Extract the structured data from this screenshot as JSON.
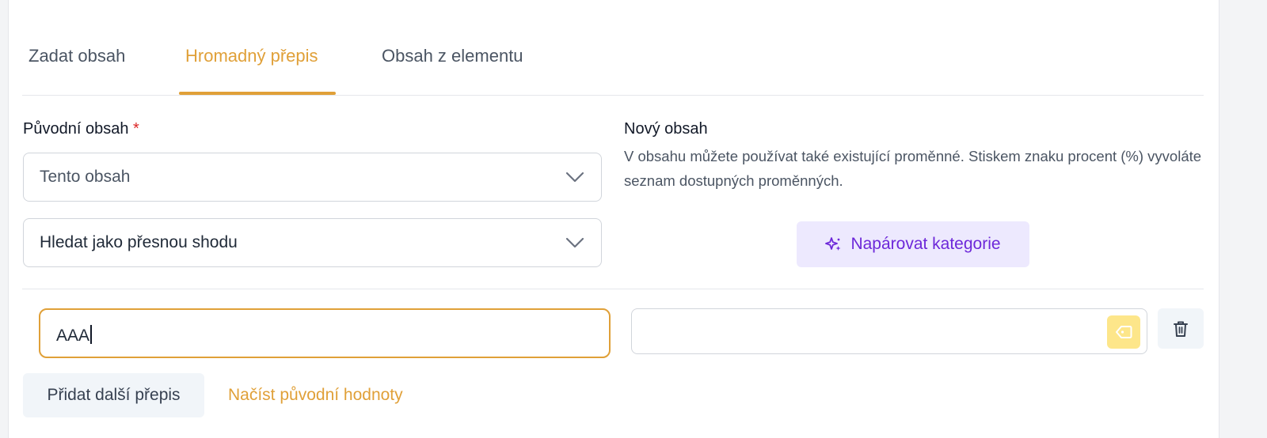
{
  "tabs": [
    {
      "label": "Zadat obsah",
      "active": false
    },
    {
      "label": "Hromadný přepis",
      "active": true
    },
    {
      "label": "Obsah z elementu",
      "active": false
    }
  ],
  "original": {
    "label": "Původní obsah",
    "required_mark": "*",
    "scope_select": "Tento obsah",
    "match_select": "Hledat jako přesnou shodu"
  },
  "new_content": {
    "label": "Nový obsah",
    "help": "V obsahu můžete používat také existující proměnné. Stiskem znaku procent (%) vyvoláte seznam dostupných proměnných.",
    "pair_button": "Napárovat kategorie"
  },
  "rewrite_row": {
    "original_value": "AAA",
    "new_value": ""
  },
  "actions": {
    "add_rewrite": "Přidat další přepis",
    "load_original": "Načíst původní hodnoty"
  },
  "icons": {
    "select": "chevron-down-icon",
    "pair": "sparkle-icon",
    "tag": "tag-icon",
    "delete": "trash-icon"
  },
  "colors": {
    "accent": "#e0a038",
    "purple": "#6d28d9",
    "purple_bg": "#ede9fe",
    "required": "#dc2626"
  }
}
